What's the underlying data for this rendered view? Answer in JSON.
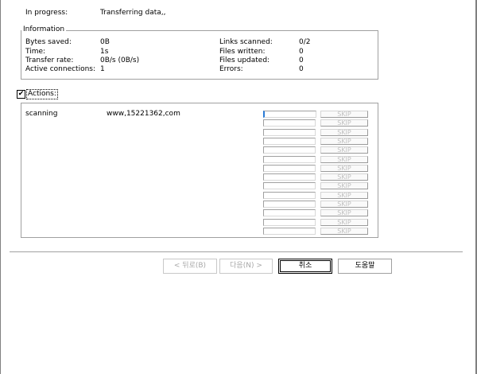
{
  "header": {
    "in_progress_label": "In progress:",
    "in_progress_value": "Transferring data,,"
  },
  "info": {
    "title": "Information",
    "bytes_saved_label": "Bytes saved:",
    "bytes_saved_value": "0B",
    "time_label": "Time:",
    "time_value": "1s",
    "transfer_rate_label": "Transfer rate:",
    "transfer_rate_value": "0B/s (0B/s)",
    "active_conn_label": "Active connections:",
    "active_conn_value": "1",
    "links_scanned_label": "Links scanned:",
    "links_scanned_value": "0/2",
    "files_written_label": "Files written:",
    "files_written_value": "0",
    "files_updated_label": "Files updated:",
    "files_updated_value": "0",
    "errors_label": "Errors:",
    "errors_value": "0"
  },
  "actions": {
    "checkbox_mark": "✔",
    "label": "Actions:",
    "row_status": "scanning",
    "row_url": "www,15221362,com",
    "skip_label": "SKIP"
  },
  "buttons": {
    "back": "< 뒤로(B)",
    "next": "다음(N) >",
    "cancel": "취소",
    "help": "도움말"
  }
}
